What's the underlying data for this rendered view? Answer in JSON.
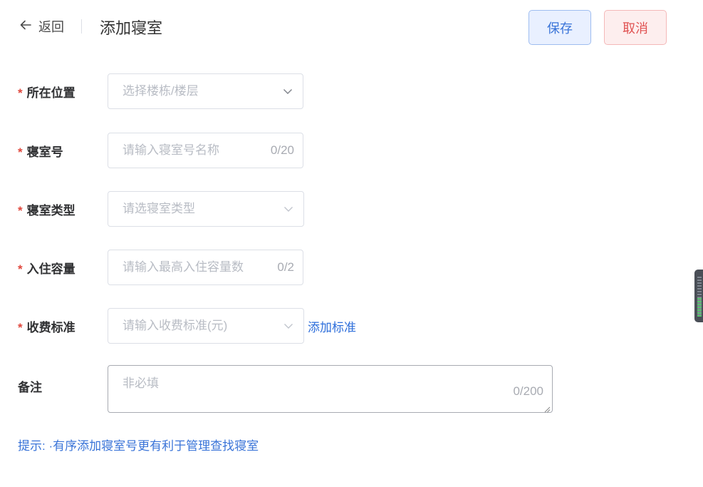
{
  "header": {
    "back_label": "返回",
    "title": "添加寝室",
    "save_label": "保存",
    "cancel_label": "取消"
  },
  "form": {
    "required_mark": "*",
    "location": {
      "label": "所在位置",
      "placeholder": "选择楼栋/楼层"
    },
    "room_no": {
      "label": "寝室号",
      "placeholder": "请输入寝室号名称",
      "count": "0/20"
    },
    "room_type": {
      "label": "寝室类型",
      "placeholder": "请选寝室类型"
    },
    "capacity": {
      "label": "入住容量",
      "placeholder": "请输入最高入住容量数",
      "count": "0/2"
    },
    "fee_standard": {
      "label": "收费标准",
      "placeholder": "请输入收费标准(元)",
      "add_link": "添加标准"
    },
    "remark": {
      "label": "备注",
      "placeholder": "非必填",
      "count": "0/200"
    }
  },
  "tip": "提示: ·有序添加寝室号更有利于管理查找寝室",
  "colors": {
    "accent": "#3a74d8",
    "danger": "#e05252",
    "required": "#e0483d"
  }
}
